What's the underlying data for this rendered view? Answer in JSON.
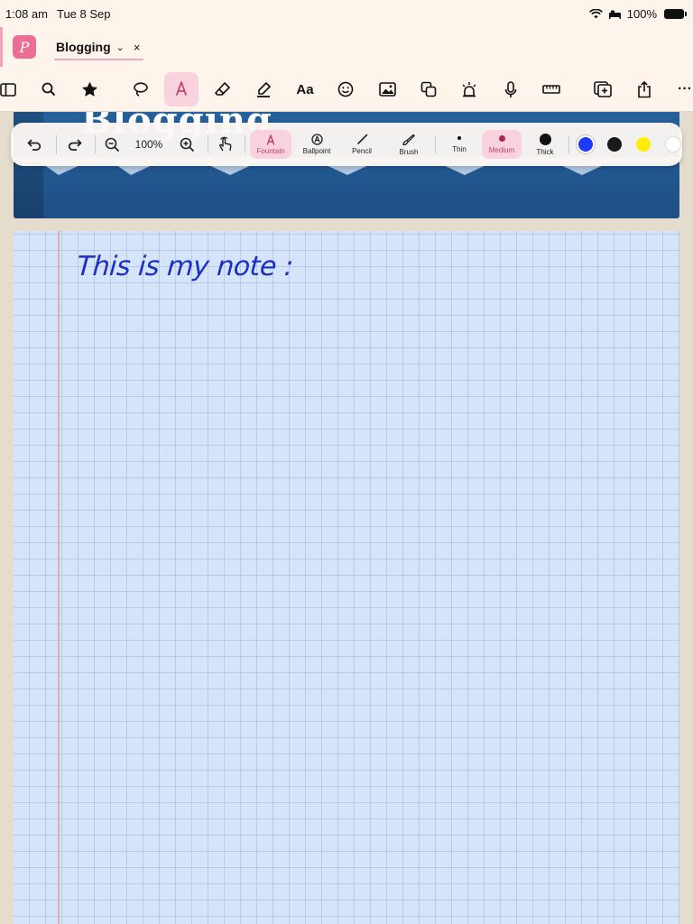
{
  "status": {
    "time": "1:08 am",
    "date": "Tue 8 Sep",
    "battery": "100%"
  },
  "tab": {
    "title": "Blogging",
    "close": "×",
    "chevron": "⌄"
  },
  "toolbar": {
    "text_tool": "Aa",
    "more": "···"
  },
  "cover": {
    "title": "Blogging"
  },
  "pen_toolbar": {
    "zoom": "100%",
    "pens": [
      {
        "label": "Fountain"
      },
      {
        "label": "Ballpoint"
      },
      {
        "label": "Pencil"
      },
      {
        "label": "Brush"
      }
    ],
    "sizes": [
      {
        "label": "Thin"
      },
      {
        "label": "Medium"
      },
      {
        "label": "Thick"
      }
    ],
    "colors": [
      "#1e3bff",
      "#1a1a1a",
      "#ffee00",
      "#ffffff"
    ],
    "accent": "#f8d2dc"
  },
  "note": {
    "handwriting": "This is my note :"
  }
}
